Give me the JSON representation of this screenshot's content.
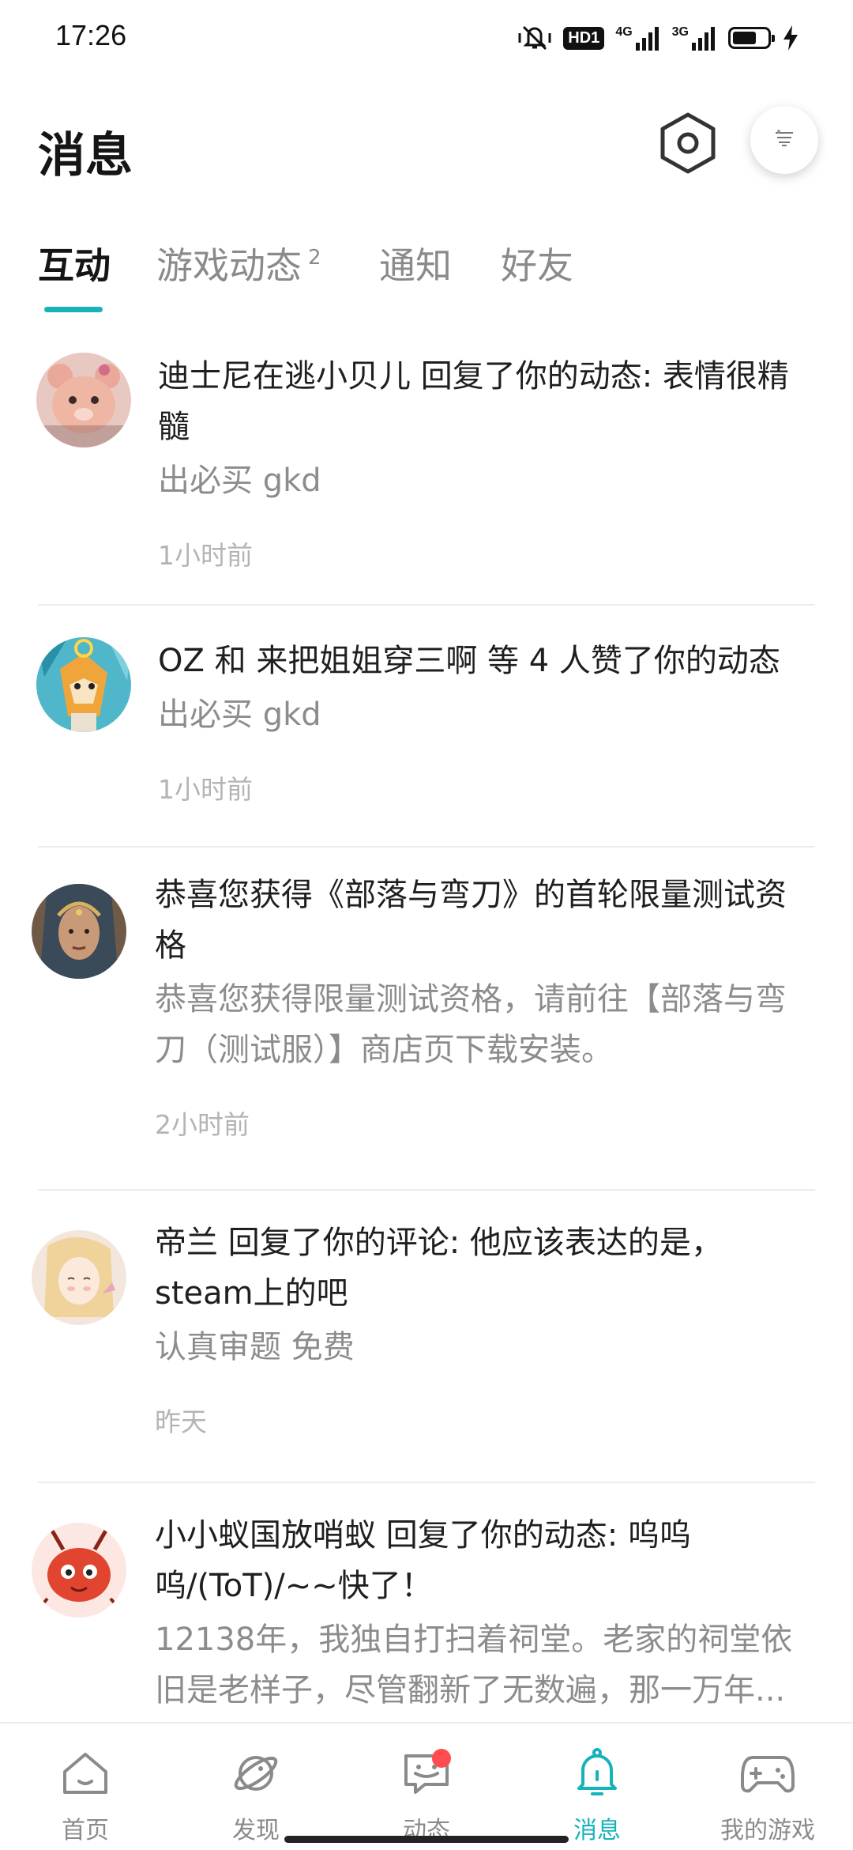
{
  "status_bar": {
    "time": "17:26",
    "hd_label": "HD1",
    "net1_label": "4G",
    "net2_label": "3G",
    "battery_level": 0.7,
    "icons": [
      "vibrate-mute-icon",
      "hd-icon",
      "signal-4g-icon",
      "signal-3g-icon",
      "battery-icon",
      "charging-icon"
    ]
  },
  "header": {
    "title": "消息",
    "settings_icon": "settings-hexagon-icon",
    "avatar_icon": "user-avatar-icon"
  },
  "tabs": [
    {
      "label": "互动",
      "active": true
    },
    {
      "label": "游戏动态",
      "badge": "2",
      "active": false
    },
    {
      "label": "通知",
      "active": false
    },
    {
      "label": "好友",
      "active": false
    }
  ],
  "messages": [
    {
      "avatar": "plush-bear-avatar",
      "title": "迪士尼在逃小贝儿 回复了你的动态: 表情很精髓",
      "subtitle": "出必买 gkd",
      "time": "1小时前"
    },
    {
      "avatar": "cartoon-fox-avatar",
      "title": "OZ 和 来把姐姐穿三啊 等 4 人赞了你的动态",
      "subtitle": "出必买 gkd",
      "time": "1小时前"
    },
    {
      "avatar": "tribal-woman-avatar",
      "title": "恭喜您获得《部落与弯刀》的首轮限量测试资格",
      "subtitle": "恭喜您获得限量测试资格，请前往【部落与弯刀（测试服）】商店页下载安装。",
      "time": "2小时前"
    },
    {
      "avatar": "anime-girl-avatar",
      "title": "帝兰 回复了你的评论: 他应该表达的是，steam上的吧",
      "subtitle": "认真审题 免费",
      "time": "昨天"
    },
    {
      "avatar": "red-ant-avatar",
      "title": "小小蚁国放哨蚁 回复了你的动态: 呜呜呜/(ToT)/~~快了！",
      "subtitle": "12138年，我独自打扫着祠堂。老家的祠堂依旧是老样子，尽管翻新了无数遍，那一万年...",
      "time": ""
    }
  ],
  "bottom_nav": [
    {
      "label": "首页",
      "icon": "home-icon",
      "active": false
    },
    {
      "label": "发现",
      "icon": "planet-icon",
      "active": false
    },
    {
      "label": "动态",
      "icon": "chat-bubble-icon",
      "active": false,
      "dot": true
    },
    {
      "label": "消息",
      "icon": "bell-icon",
      "active": true
    },
    {
      "label": "我的游戏",
      "icon": "gamepad-icon",
      "active": false
    }
  ],
  "colors": {
    "accent": "#16b3b8",
    "badge_red": "#ff4d4f",
    "text_primary": "#1f1f1f",
    "text_secondary": "#8c8c8c",
    "text_muted": "#b4b4b4"
  }
}
